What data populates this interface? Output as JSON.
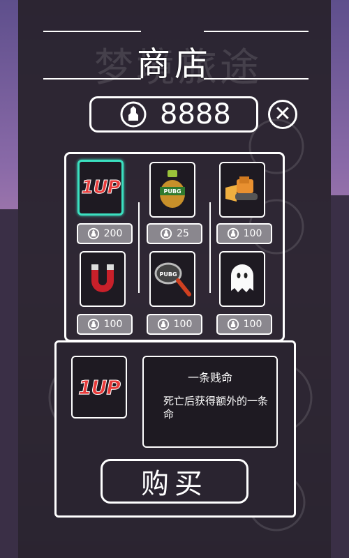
{
  "watermark_title": "梦境旅途",
  "shop_title": "商店",
  "coins": "8888",
  "close_label": "✕",
  "items": [
    {
      "name": "1up",
      "price": "200",
      "selected": true
    },
    {
      "name": "grenade",
      "price": "25",
      "selected": false
    },
    {
      "name": "bulldozer",
      "price": "100",
      "selected": false
    },
    {
      "name": "magnet",
      "price": "100",
      "selected": false
    },
    {
      "name": "frying-pan",
      "price": "100",
      "selected": false
    },
    {
      "name": "ghost",
      "price": "100",
      "selected": false
    }
  ],
  "labels": {
    "oneup_text": "1UP",
    "pubg_text": "PUBG"
  },
  "detail": {
    "name": "一条贱命",
    "description": "死亡后获得额外的一条命"
  },
  "buy_label": "购买",
  "colors": {
    "selected": "#3be0c0",
    "panel": "#2a2430",
    "price_bg": "#8a878e"
  }
}
